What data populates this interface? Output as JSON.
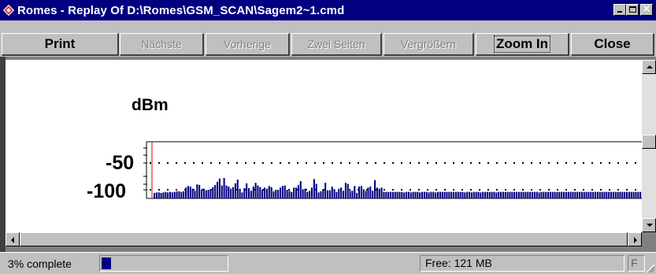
{
  "window": {
    "title": "Romes - Replay Of D:\\Romes\\GSM_SCAN\\Sagem2~1.cmd",
    "close_glyph": "×"
  },
  "toolbar": {
    "print_label": "Print",
    "next_label": "Nächste",
    "previous_label": "Vorherige",
    "two_pages_label": "Zwei Seiten",
    "enlarge_label": "Vergrößern",
    "zoom_in_label": "Zoom In",
    "close_label": "Close"
  },
  "chart": {
    "unit_label": "dBm",
    "tick_minus50": "-50",
    "tick_minus100": "-100"
  },
  "chart_data": {
    "type": "bar",
    "ylabel": "dBm",
    "y_tick_labels": [
      "-50",
      "-100"
    ],
    "ylim": [
      -110,
      -40
    ],
    "reference_lines": [
      -50,
      -100
    ],
    "bar_color": "#000080",
    "values": [
      -106,
      -105,
      -105,
      -106,
      -105,
      -104,
      -105,
      -104,
      -105,
      -104,
      -103,
      -103,
      -104,
      -103,
      -96,
      -93,
      -94,
      -98,
      -102,
      -90,
      -91,
      -100,
      -98,
      -101,
      -100,
      -99,
      -95,
      -91,
      -85,
      -79,
      -92,
      -78,
      -92,
      -94,
      -98,
      -95,
      -88,
      -81,
      -98,
      -105,
      -97,
      -88,
      -97,
      -102,
      -94,
      -87,
      -92,
      -95,
      -100,
      -96,
      -98,
      -93,
      -95,
      -103,
      -100,
      -100,
      -96,
      -93,
      -92,
      -100,
      -102,
      -104,
      -96,
      -96,
      -91,
      -84,
      -99,
      -98,
      -104,
      -102,
      -96,
      -80,
      -89,
      -105,
      -103,
      -99,
      -87,
      -101,
      -101,
      -94,
      -99,
      -104,
      -98,
      -96,
      -102,
      -87,
      -89,
      -102,
      -102,
      -93,
      -106,
      -94,
      -93,
      -99,
      -102,
      -96,
      -94,
      -102,
      -82,
      -96,
      -98,
      -96,
      -104,
      -104,
      -104,
      -104,
      -104,
      -104,
      -104,
      -104,
      -104,
      -105,
      -104,
      -104,
      -105,
      -104,
      -104,
      -104,
      -105,
      -104,
      -104,
      -104,
      -105,
      -104,
      -104,
      -105,
      -104,
      -104,
      -104,
      -104,
      -104,
      -104,
      -104,
      -104,
      -104,
      -104,
      -104,
      -104,
      -105,
      -104,
      -104,
      -105,
      -104,
      -104,
      -104,
      -105,
      -104,
      -104,
      -104,
      -104,
      -104,
      -104,
      -105,
      -104,
      -104,
      -104,
      -104,
      -104,
      -104,
      -104,
      -104,
      -104,
      -104,
      -104,
      -104,
      -104,
      -104,
      -104,
      -104,
      -104,
      -104,
      -105,
      -104,
      -104,
      -104,
      -104,
      -104,
      -104,
      -104,
      -104,
      -104,
      -104,
      -104,
      -104,
      -104,
      -104,
      -104,
      -104,
      -104,
      -104,
      -104,
      -104,
      -104,
      -104,
      -104,
      -104,
      -104,
      -104,
      -104,
      -104,
      -104,
      -104,
      -104,
      -104,
      -104,
      -104,
      -104,
      -104,
      -104,
      -104,
      -104,
      -104,
      -104,
      -104,
      -104,
      -104,
      -104
    ]
  },
  "status": {
    "progress_text": "3% complete",
    "progress_fraction": 0.03,
    "free_memory": "Free: 121 MB",
    "flag": "F"
  }
}
